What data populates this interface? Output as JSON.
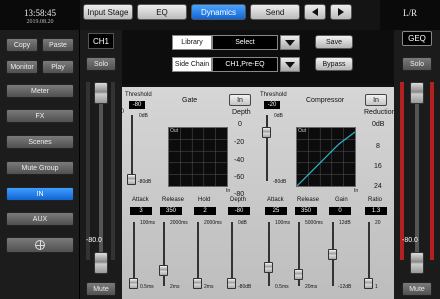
{
  "status": {
    "time": "13:58:45",
    "date": "2019.08.20",
    "bus": "L/R"
  },
  "nav": {
    "tabs": [
      {
        "label": "Input Stage"
      },
      {
        "label": "EQ"
      },
      {
        "label": "Dynamics",
        "active": true
      },
      {
        "label": "Send"
      }
    ]
  },
  "sidebar": {
    "copy": "Copy",
    "paste": "Paste",
    "monitor": "Monitor",
    "play": "Play",
    "items": [
      "Meter",
      "FX",
      "Scenes",
      "Mute Group",
      "IN",
      "AUX"
    ],
    "active_item": "IN"
  },
  "channel": {
    "name": "CH1",
    "solo": "Solo",
    "mute": "Mute",
    "level": "-80.0",
    "scale": [
      "0",
      "-5",
      "-10",
      "-20",
      "-30",
      "-40",
      "-50"
    ]
  },
  "master": {
    "name": "GEQ",
    "solo": "Solo",
    "mute": "Mute",
    "level": "-80.0",
    "scale": [
      "0",
      "-5",
      "-10",
      "-20",
      "-30",
      "-40",
      "-50"
    ]
  },
  "library": {
    "label": "Library",
    "value": "Select",
    "save": "Save"
  },
  "sidechain": {
    "label": "Side Chain",
    "value": "CH1,Pre-EQ",
    "bypass": "Bypass"
  },
  "gate": {
    "title": "Gate",
    "in": "In",
    "threshold": {
      "label": "Threshold",
      "value": "-80",
      "top": "0dB",
      "bottom": "-80dB"
    },
    "depth": {
      "label": "Depth",
      "scale": [
        "0",
        "-20",
        "-40",
        "-60",
        "-80"
      ]
    },
    "graph": {
      "out": "Out",
      "in": "In"
    },
    "params": [
      {
        "label": "Attack",
        "value": "3",
        "top": "100ms",
        "bottom": "0.5ms"
      },
      {
        "label": "Release",
        "value": "350",
        "top": "2000ms",
        "bottom": "2ms"
      },
      {
        "label": "Hold",
        "value": "2",
        "top": "2000ms",
        "bottom": "2ms"
      },
      {
        "label": "Depth",
        "value": "-80",
        "top": "0dB",
        "bottom": "-80dB"
      }
    ]
  },
  "compressor": {
    "title": "Compressor",
    "in": "In",
    "threshold": {
      "label": "Threshold",
      "value": "-20",
      "top": "0dB",
      "bottom": "-80dB"
    },
    "reduction": {
      "label": "Reduction",
      "scale": [
        "0dB",
        "8",
        "16",
        "24"
      ]
    },
    "graph": {
      "out": "Out",
      "in": "In"
    },
    "params": [
      {
        "label": "Attack",
        "value": "25",
        "top": "100ms",
        "bottom": "0.5ms"
      },
      {
        "label": "Release",
        "value": "350",
        "top": "5000ms",
        "bottom": "20ms"
      },
      {
        "label": "Gain",
        "value": "0",
        "top": "12dB",
        "bottom": "-12dB"
      },
      {
        "label": "Ratio",
        "value": "1.3",
        "top": "20",
        "bottom": "1"
      }
    ]
  }
}
